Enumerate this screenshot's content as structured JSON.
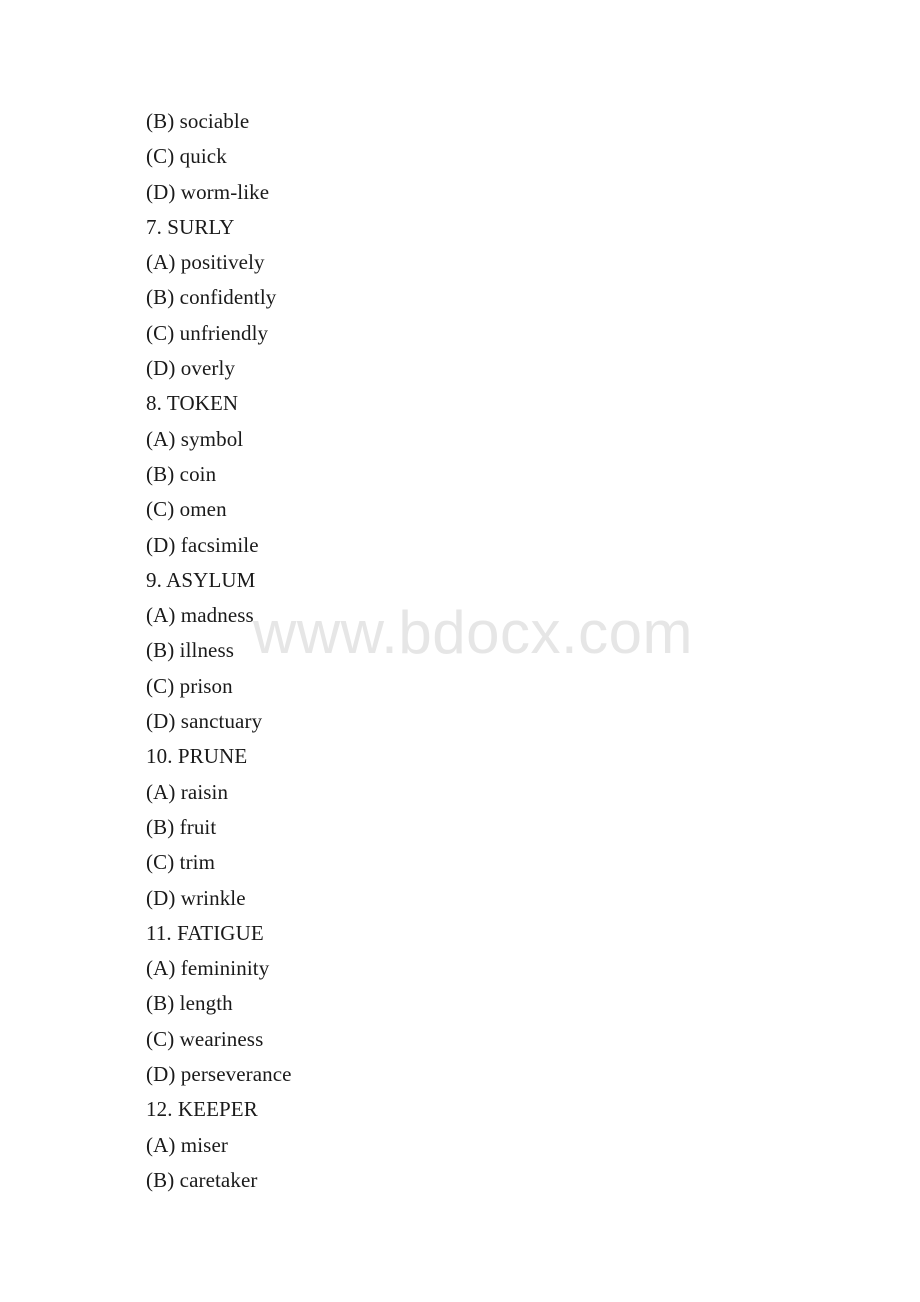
{
  "document": {
    "background_color": "#ffffff",
    "text_color": "#1a1a1a"
  },
  "watermark": {
    "text": "www.bdocx.com",
    "color": "#e6e6e6"
  },
  "lines": [
    {
      "kind": "option",
      "text": "(B) sociable"
    },
    {
      "kind": "option",
      "text": "(C) quick"
    },
    {
      "kind": "option",
      "text": "(D) worm-like"
    },
    {
      "kind": "question",
      "text": "7. SURLY"
    },
    {
      "kind": "option",
      "text": "(A) positively"
    },
    {
      "kind": "option",
      "text": "(B) confidently"
    },
    {
      "kind": "option",
      "text": "(C) unfriendly"
    },
    {
      "kind": "option",
      "text": "(D) overly"
    },
    {
      "kind": "question",
      "text": "8. TOKEN"
    },
    {
      "kind": "option",
      "text": "(A) symbol"
    },
    {
      "kind": "option",
      "text": "(B) coin"
    },
    {
      "kind": "option",
      "text": "(C) omen"
    },
    {
      "kind": "option",
      "text": "(D) facsimile"
    },
    {
      "kind": "question",
      "text": "9. ASYLUM"
    },
    {
      "kind": "option",
      "text": "(A) madness"
    },
    {
      "kind": "option",
      "text": "(B) illness"
    },
    {
      "kind": "option",
      "text": "(C) prison"
    },
    {
      "kind": "option",
      "text": "(D) sanctuary"
    },
    {
      "kind": "question",
      "text": "10. PRUNE"
    },
    {
      "kind": "option",
      "text": "(A) raisin"
    },
    {
      "kind": "option",
      "text": "(B) fruit"
    },
    {
      "kind": "option",
      "text": "(C) trim"
    },
    {
      "kind": "option",
      "text": "(D) wrinkle"
    },
    {
      "kind": "question",
      "text": "11. FATIGUE"
    },
    {
      "kind": "option",
      "text": "(A) femininity"
    },
    {
      "kind": "option",
      "text": "(B) length"
    },
    {
      "kind": "option",
      "text": "(C) weariness"
    },
    {
      "kind": "option",
      "text": "(D) perseverance"
    },
    {
      "kind": "question",
      "text": "12. KEEPER"
    },
    {
      "kind": "option",
      "text": "(A) miser"
    },
    {
      "kind": "option",
      "text": "(B) caretaker"
    }
  ]
}
